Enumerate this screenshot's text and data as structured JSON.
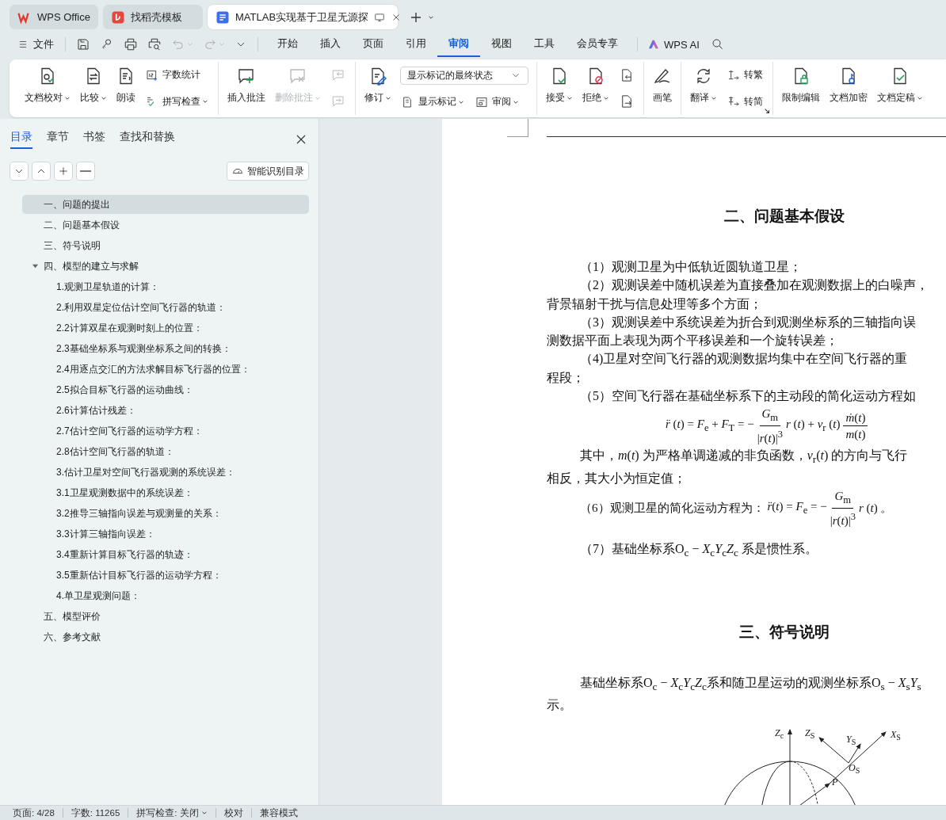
{
  "tabs": [
    {
      "label": "WPS Office",
      "selected": false
    },
    {
      "label": "找稻壳模板",
      "selected": false
    },
    {
      "label": "MATLAB实现基于卫星无源探",
      "selected": true
    }
  ],
  "menu_bar": {
    "file": "文件",
    "quick_access": [
      {
        "disabled": false,
        "dropdown": false
      },
      {
        "disabled": false,
        "dropdown": false
      },
      {
        "disabled": false,
        "dropdown": false
      },
      {
        "disabled": false,
        "dropdown": false
      },
      {
        "disabled": true,
        "dropdown": true
      },
      {
        "disabled": true,
        "dropdown": true
      }
    ],
    "tabs": [
      {
        "label": "开始",
        "selected": false
      },
      {
        "label": "插入",
        "selected": false
      },
      {
        "label": "页面",
        "selected": false
      },
      {
        "label": "引用",
        "selected": false
      },
      {
        "label": "审阅",
        "selected": true
      },
      {
        "label": "视图",
        "selected": false
      },
      {
        "label": "工具",
        "selected": false
      },
      {
        "label": "会员专享",
        "selected": false
      }
    ],
    "ai_button": "WPS AI"
  },
  "ribbon": {
    "groups": [
      {
        "items": [
          {
            "kind": "big",
            "label": "文档校对",
            "dropdown": true,
            "disabled": false
          },
          {
            "kind": "big",
            "label": "比较",
            "dropdown": true,
            "disabled": false
          },
          {
            "kind": "big",
            "label": "朗读",
            "dropdown": false,
            "disabled": false
          },
          {
            "kind": "stack",
            "rows": [
              [
                {
                  "kind": "small",
                  "label": "字数统计",
                  "dropdown": false,
                  "disabled": false
                }
              ],
              [
                {
                  "kind": "small",
                  "label": "拼写检查",
                  "dropdown": true,
                  "disabled": false
                }
              ]
            ]
          }
        ]
      },
      {
        "items": [
          {
            "kind": "big",
            "label": "插入批注",
            "dropdown": false,
            "disabled": false
          },
          {
            "kind": "big",
            "label": "删除批注",
            "dropdown": true,
            "disabled": true
          },
          {
            "kind": "stack",
            "rows": [
              [
                {
                  "kind": "icon",
                  "disabled": true
                }
              ],
              [
                {
                  "kind": "icon",
                  "disabled": true
                }
              ]
            ]
          }
        ]
      },
      {
        "items": [
          {
            "kind": "big",
            "label": "修订",
            "dropdown": true,
            "disabled": false
          },
          {
            "kind": "stack",
            "rows": [
              [
                {
                  "kind": "select",
                  "value": "显示标记的最终状态"
                }
              ],
              [
                {
                  "kind": "small",
                  "label": "显示标记",
                  "dropdown": true,
                  "disabled": false
                },
                {
                  "kind": "small",
                  "label": "审阅",
                  "dropdown": true,
                  "disabled": false
                }
              ]
            ]
          }
        ]
      },
      {
        "items": [
          {
            "kind": "big",
            "label": "接受",
            "dropdown": true,
            "disabled": false
          },
          {
            "kind": "big",
            "label": "拒绝",
            "dropdown": true,
            "disabled": false
          },
          {
            "kind": "stack",
            "rows": [
              [
                {
                  "kind": "icon",
                  "disabled": false
                }
              ],
              [
                {
                  "kind": "icon",
                  "disabled": false
                }
              ]
            ]
          }
        ]
      },
      {
        "items": [
          {
            "kind": "big",
            "label": "画笔",
            "dropdown": false,
            "disabled": false
          }
        ]
      },
      {
        "launcher": true,
        "items": [
          {
            "kind": "big",
            "label": "翻译",
            "dropdown": true,
            "disabled": false
          },
          {
            "kind": "stack",
            "rows": [
              [
                {
                  "kind": "small",
                  "label": "转繁",
                  "dropdown": false,
                  "disabled": false
                }
              ],
              [
                {
                  "kind": "small",
                  "label": "转简",
                  "dropdown": false,
                  "disabled": false
                }
              ]
            ]
          }
        ]
      },
      {
        "items": [
          {
            "kind": "big",
            "label": "限制编辑",
            "dropdown": false,
            "disabled": false
          },
          {
            "kind": "big",
            "label": "文档加密",
            "dropdown": false,
            "disabled": false
          },
          {
            "kind": "big",
            "label": "文档定稿",
            "dropdown": true,
            "disabled": false
          }
        ]
      }
    ]
  },
  "nav_pane": {
    "tabs": [
      {
        "label": "目录",
        "selected": true
      },
      {
        "label": "章节",
        "selected": false
      },
      {
        "label": "书签",
        "selected": false
      },
      {
        "label": "查找和替换",
        "selected": false
      }
    ],
    "smart_button": "智能识别目录",
    "outline": [
      {
        "label": "一、问题的提出",
        "selected": true
      },
      {
        "label": "二、问题基本假设",
        "selected": false
      },
      {
        "label": "三、符号说明",
        "selected": false
      },
      {
        "label": "四、模型的建立与求解",
        "selected": false,
        "expanded": true,
        "children": [
          {
            "label": "1.观测卫星轨道的计算：",
            "selected": false
          },
          {
            "label": "2.利用双星定位估计空间飞行器的轨道：",
            "selected": false
          },
          {
            "label": "2.2计算双星在观测时刻上的位置：",
            "selected": false
          },
          {
            "label": "2.3基础坐标系与观测坐标系之间的转换：",
            "selected": false
          },
          {
            "label": "2.4用逐点交汇的方法求解目标飞行器的位置：",
            "selected": false
          },
          {
            "label": "2.5拟合目标飞行器的运动曲线：",
            "selected": false
          },
          {
            "label": "2.6计算估计残差：",
            "selected": false
          },
          {
            "label": "2.7估计空间飞行器的运动学方程：",
            "selected": false
          },
          {
            "label": "2.8估计空间飞行器的轨道：",
            "selected": false
          },
          {
            "label": "3.估计卫星对空间飞行器观测的系统误差：",
            "selected": false
          },
          {
            "label": "3.1卫星观测数据中的系统误差：",
            "selected": false
          },
          {
            "label": "3.2推导三轴指向误差与观测量的关系：",
            "selected": false
          },
          {
            "label": "3.3计算三轴指向误差：",
            "selected": false
          },
          {
            "label": "3.4重新计算目标飞行器的轨迹：",
            "selected": false
          },
          {
            "label": "3.5重新估计目标飞行器的运动学方程：",
            "selected": false
          },
          {
            "label": "4.单卫星观测问题：",
            "selected": false
          }
        ]
      },
      {
        "label": "五、模型评价",
        "selected": false
      },
      {
        "label": "六、参考文献",
        "selected": false
      }
    ]
  },
  "document": {
    "blocks": [
      {
        "kind": "heading",
        "text": "二、问题基本假设"
      },
      {
        "kind": "paragraph",
        "lines": [
          "（1）观测卫星为中低轨近圆轨道卫星；"
        ]
      },
      {
        "kind": "paragraph",
        "lines": [
          "（2）观测误差中随机误差为直接叠加在观测数据上的白噪声，",
          "背景辐射干扰与信息处理等多个方面；"
        ]
      },
      {
        "kind": "paragraph",
        "lines": [
          "（3）观测误差中系统误差为折合到观测坐标系的三轴指向误",
          "测数据平面上表现为两个平移误差和一个旋转误差；"
        ]
      },
      {
        "kind": "paragraph",
        "lines": [
          "（4)卫星对空间飞行器的观测数据均集中在空间飞行器的重",
          "程段；"
        ]
      },
      {
        "kind": "paragraph",
        "lines": [
          "（5）空间飞行器在基础坐标系下的主动段的简化运动方程如"
        ]
      },
      {
        "kind": "formula",
        "parts": [
          {
            "kind": "text",
            "text": "*r̈* (*t*) = *F*$_{e}$ + *F*$_{T}$ = −"
          },
          {
            "kind": "fraction",
            "numerator": "*G*$_{m}$",
            "denominator": "|*r*(*t*)|$^{3}$"
          },
          {
            "kind": "text",
            "text": "*r* (*t*) + *v*$_{r}$ (*t*)"
          },
          {
            "kind": "fraction",
            "numerator": "*ṁ*(*t*)",
            "denominator": "*m*(*t*)"
          }
        ]
      },
      {
        "kind": "paragraph",
        "lines": [
          "其中，*m*(*t*) 为严格单调递减的非负函数，*v*$_{r}$(*t*) 的方向与飞行",
          "相反，其大小为恒定值；"
        ]
      },
      {
        "kind": "formula_line",
        "parts": [
          {
            "kind": "text",
            "text": "（6）观测卫星的简化运动方程为："
          },
          {
            "kind": "text",
            "text": "*r̈*(*t*) = *F*$_{e}$ = −"
          },
          {
            "kind": "fraction",
            "numerator": "*G*$_{m}$",
            "denominator": "|*r*(*t*)|$^{3}$"
          },
          {
            "kind": "text",
            "text": "*r* (*t*) 。"
          }
        ]
      },
      {
        "kind": "paragraph",
        "lines": [
          "（7）基础坐标系O$_{c}$ − *X*$_{c}$*Y*$_{c}$*Z*$_{c}$ 系是惯性系。"
        ]
      },
      {
        "kind": "heading",
        "text": "三、符号说明"
      },
      {
        "kind": "paragraph",
        "lines": [
          "基础坐标系O$_{c}$ − *X*$_{c}$*Y*$_{c}$*Z*$_{c}$系和随卫星运动的观测坐标系O$_{s}$ − *X*$_{s}$*Y*$_{s}$",
          "示。"
        ]
      },
      {
        "kind": "figure",
        "labels": [
          "*Z*$_{c}$",
          "*Z*$_{S}$",
          "*Y*$_{S}$",
          "*X*$_{S}$",
          "*O*$_{S}$",
          "*P*"
        ]
      }
    ]
  },
  "status_bar": {
    "items": [
      {
        "label": "页面: 4/28",
        "dropdown": false
      },
      {
        "label": "字数: 11265",
        "dropdown": false
      },
      {
        "label": "拼写检查: 关闭",
        "dropdown": true
      },
      {
        "label": "校对",
        "dropdown": false
      },
      {
        "label": "兼容模式",
        "dropdown": false
      }
    ]
  }
}
